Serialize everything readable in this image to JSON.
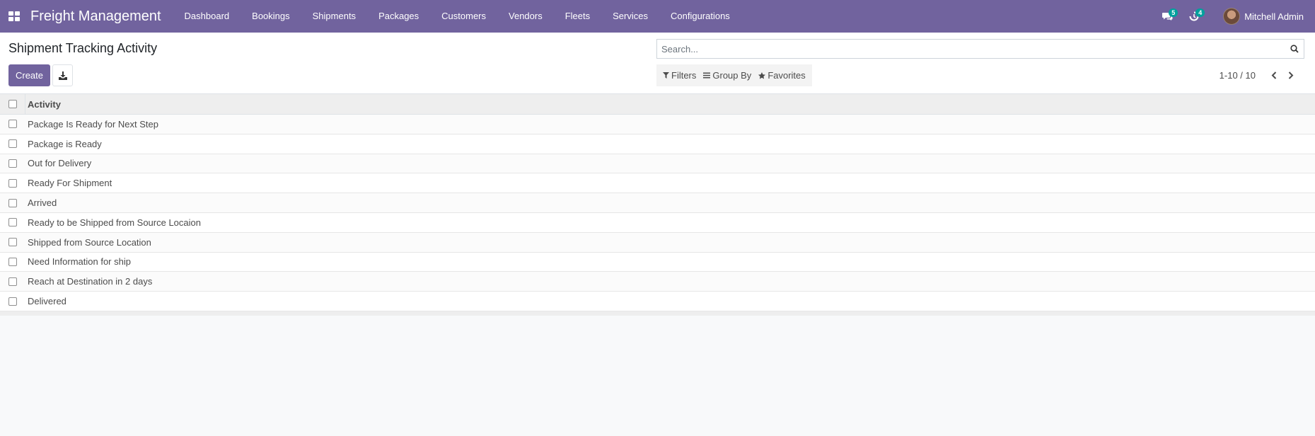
{
  "navbar": {
    "brand": "Freight Management",
    "menu": [
      "Dashboard",
      "Bookings",
      "Shipments",
      "Packages",
      "Customers",
      "Vendors",
      "Fleets",
      "Services",
      "Configurations"
    ],
    "messages_count": "5",
    "activities_count": "4",
    "user_name": "Mitchell Admin"
  },
  "control_panel": {
    "title": "Shipment Tracking Activity",
    "create_label": "Create",
    "search_placeholder": "Search...",
    "filters_label": "Filters",
    "group_by_label": "Group By",
    "favorites_label": "Favorites",
    "pager": "1-10 / 10"
  },
  "list": {
    "column": "Activity",
    "rows": [
      "Package Is Ready for Next Step",
      "Package is Ready",
      "Out for Delivery",
      "Ready For Shipment",
      "Arrived",
      "Ready to be Shipped from Source Locaion",
      "Shipped from Source Location",
      "Need Information for ship",
      "Reach at Destination in 2 days",
      "Delivered"
    ]
  },
  "colors": {
    "brand": "#71639e",
    "badge": "#00a09d"
  }
}
